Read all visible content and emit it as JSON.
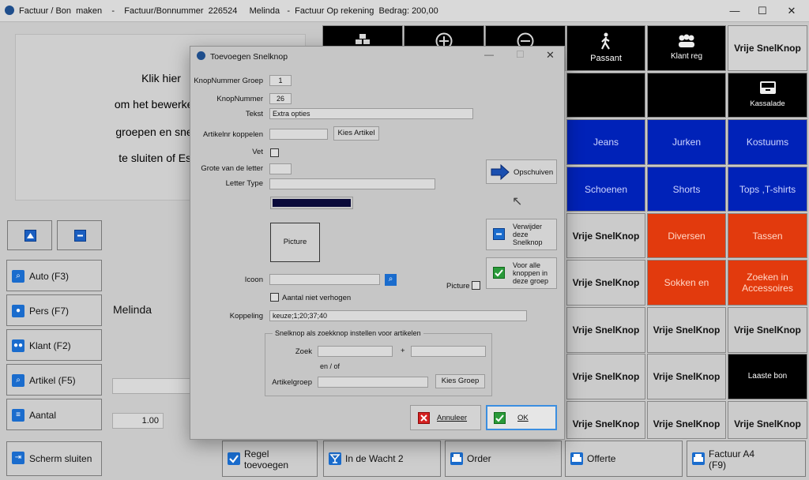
{
  "window": {
    "title": "Factuur / Bon  maken    -    Factuur/Bonnummer  226524     Melinda   -  Factuur Op rekening  Bedrag: 200,00",
    "minimize": "—",
    "maximize": "☐",
    "close": "✕"
  },
  "info_panel": {
    "lines": [
      "Klik hier",
      "om het bewerken v",
      "groepen en snelkn",
      "te sluiten of Esc-t"
    ]
  },
  "left_buttons": {
    "auto": "Auto (F3)",
    "pers": "Pers (F7)",
    "klant": "Klant (F2)",
    "artikel": "Artikel (F5)",
    "aantal": "Aantal",
    "scherm_sluiten": "Scherm sluiten"
  },
  "customer_name": "Melinda",
  "quantity_value": "1.00",
  "grid": {
    "passant": "Passant",
    "klant_reg": "Klant reg",
    "vrije_snelknop": "Vrije SnelKnop",
    "kassalade": "Kassalade",
    "jeans": "Jeans",
    "jurken": "Jurken",
    "kostuums": "Kostuums",
    "schoenen": "Schoenen",
    "shorts": "Shorts",
    "tops": "Tops ,T-shirts",
    "diversen": "Diversen",
    "tassen": "Tassen",
    "sokken": "Sokken en Panty's",
    "zoeken": "Zoeken in Accessoires",
    "laaste_bon": "Laaste bon"
  },
  "bottom_buttons": {
    "regel_toevoegen": "Regel toevoegen",
    "in_de_wacht": "In de Wacht 2",
    "order": "Order",
    "offerte": "Offerte",
    "factuur_a4": "Factuur A4 (F9)"
  },
  "dialog": {
    "title": "Toevoegen Snelknop",
    "knopnummer_groep_label": "KnopNummer Groep",
    "knopnummer_groep_value": "1",
    "knopnummer_label": "KnopNummer",
    "knopnummer_value": "26",
    "tekst_label": "Tekst",
    "tekst_value": "Extra opties",
    "artikelnr_label": "Artikelnr koppelen",
    "kies_artikel": "Kies Artikel",
    "vet_label": "Vet",
    "grote_label": "Grote van de letter",
    "letter_type_label": "Letter Type",
    "color_swatch": "#0a0a3a",
    "picture_box": "Picture",
    "icoon_label": "Icoon",
    "picture_check_label": "Picture",
    "aantal_check_label": "Aantal niet verhogen",
    "koppeling_label": "Koppeling",
    "koppeling_value": "keuze;1;20;37;40",
    "group_title": "Snelknop als zoekknop instellen voor artikelen",
    "zoek_label": "Zoek",
    "plus": "+",
    "en_of": "en / of",
    "artikelgroep_label": "Artikelgroep",
    "kies_groep": "Kies Groep",
    "opschuiven": "Opschuiven",
    "verwijder": "Verwijder deze Snelknop",
    "voor_alle": "Voor alle knoppen in deze groep",
    "annuleer": "Annuleer",
    "ok": "OK"
  }
}
